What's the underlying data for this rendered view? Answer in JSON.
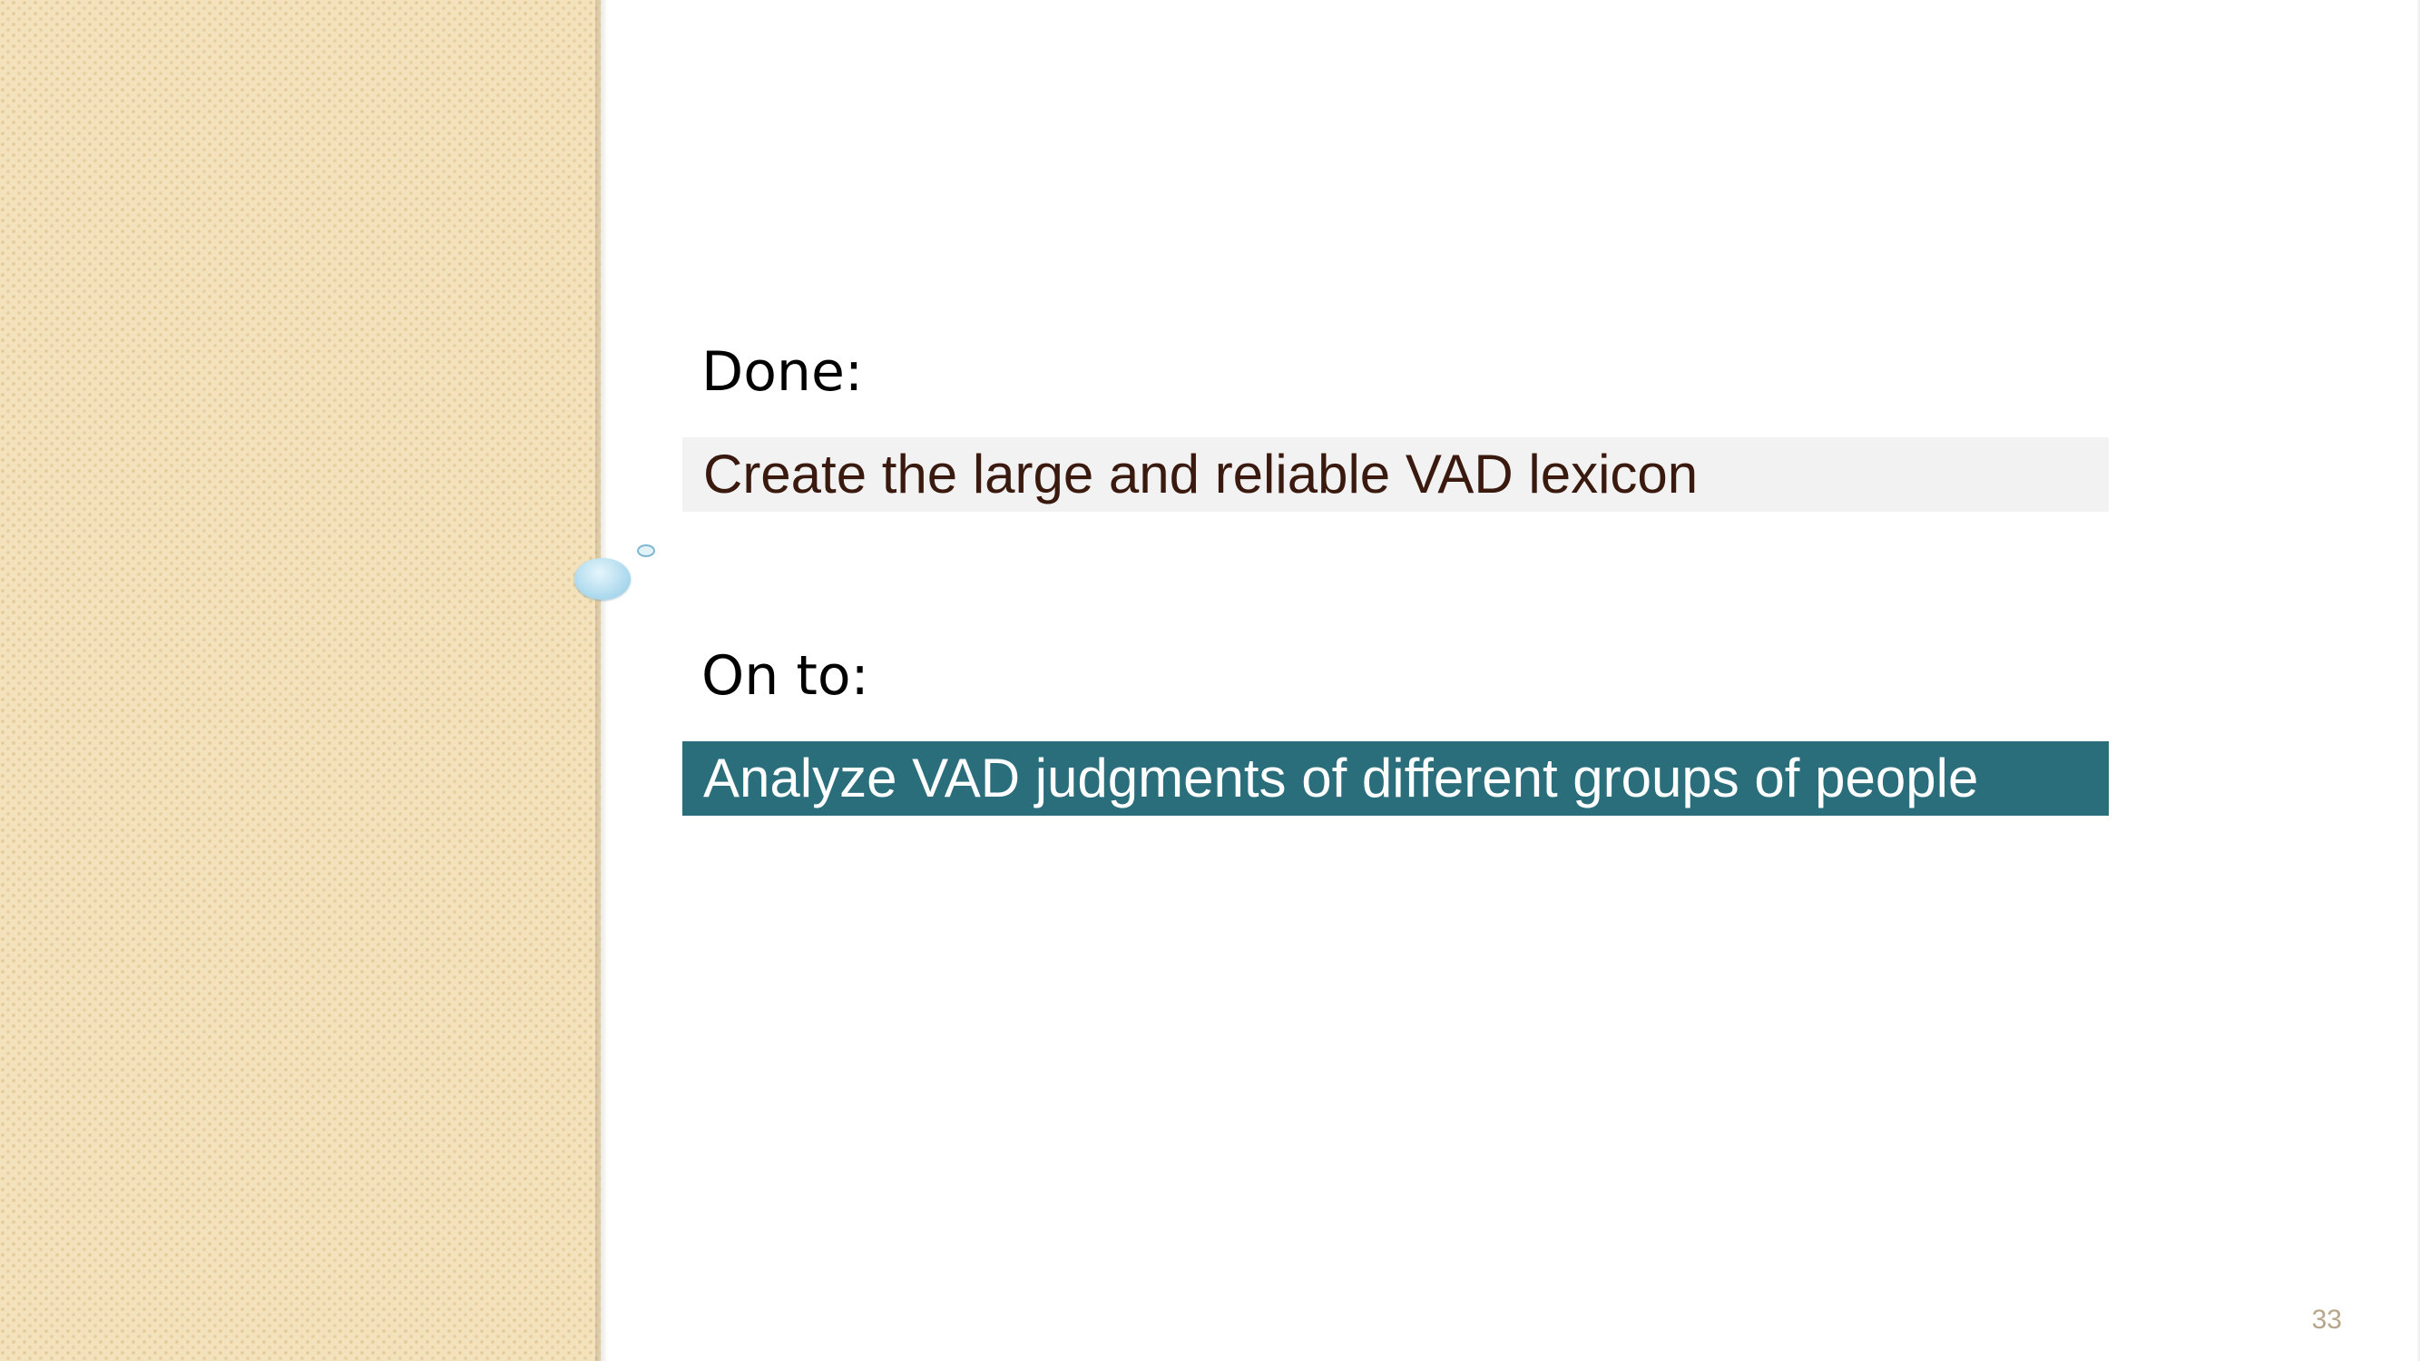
{
  "slide": {
    "done_label": "Done:",
    "done_item": "Create the large and reliable VAD lexicon",
    "onto_label": "On to:",
    "onto_item": "Analyze VAD judgments of different groups of people",
    "page_number": "33"
  },
  "colors": {
    "left_panel": "#f3e2bb",
    "done_box": "#f2f2f2",
    "done_text": "#3a1a0e",
    "onto_box": "#2a6e7c",
    "onto_text": "#ffffff",
    "page_number": "#b8a58a"
  }
}
